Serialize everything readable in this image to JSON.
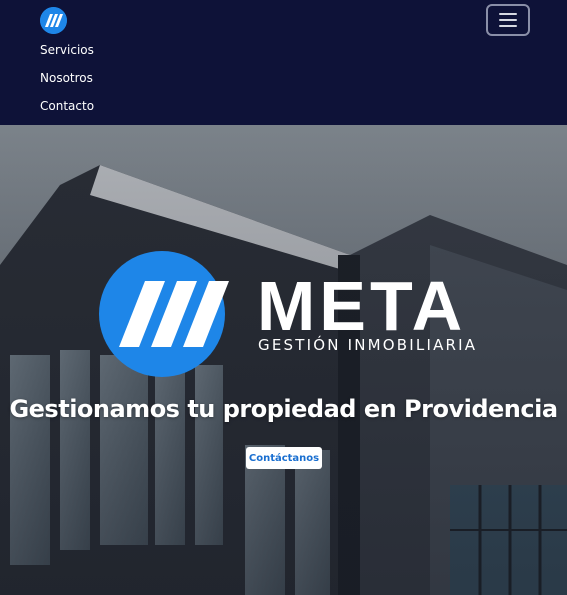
{
  "navbar": {
    "logo_icon": "meta-logo-icon",
    "toggler_icon": "hamburger-icon",
    "links": [
      {
        "label": "Servicios"
      },
      {
        "label": "Nosotros"
      },
      {
        "label": "Contacto"
      }
    ]
  },
  "hero": {
    "logo": {
      "brand": "META",
      "tagline": "GESTIÓN INMOBILIARIA"
    },
    "heading": "Gestionamos tu propiedad en Providencia",
    "cta_label": "Contáctanos"
  },
  "colors": {
    "nav_bg": "#0e1238",
    "brand_blue": "#1e86e8",
    "cta_text": "#1a6fd0",
    "white": "#ffffff"
  }
}
